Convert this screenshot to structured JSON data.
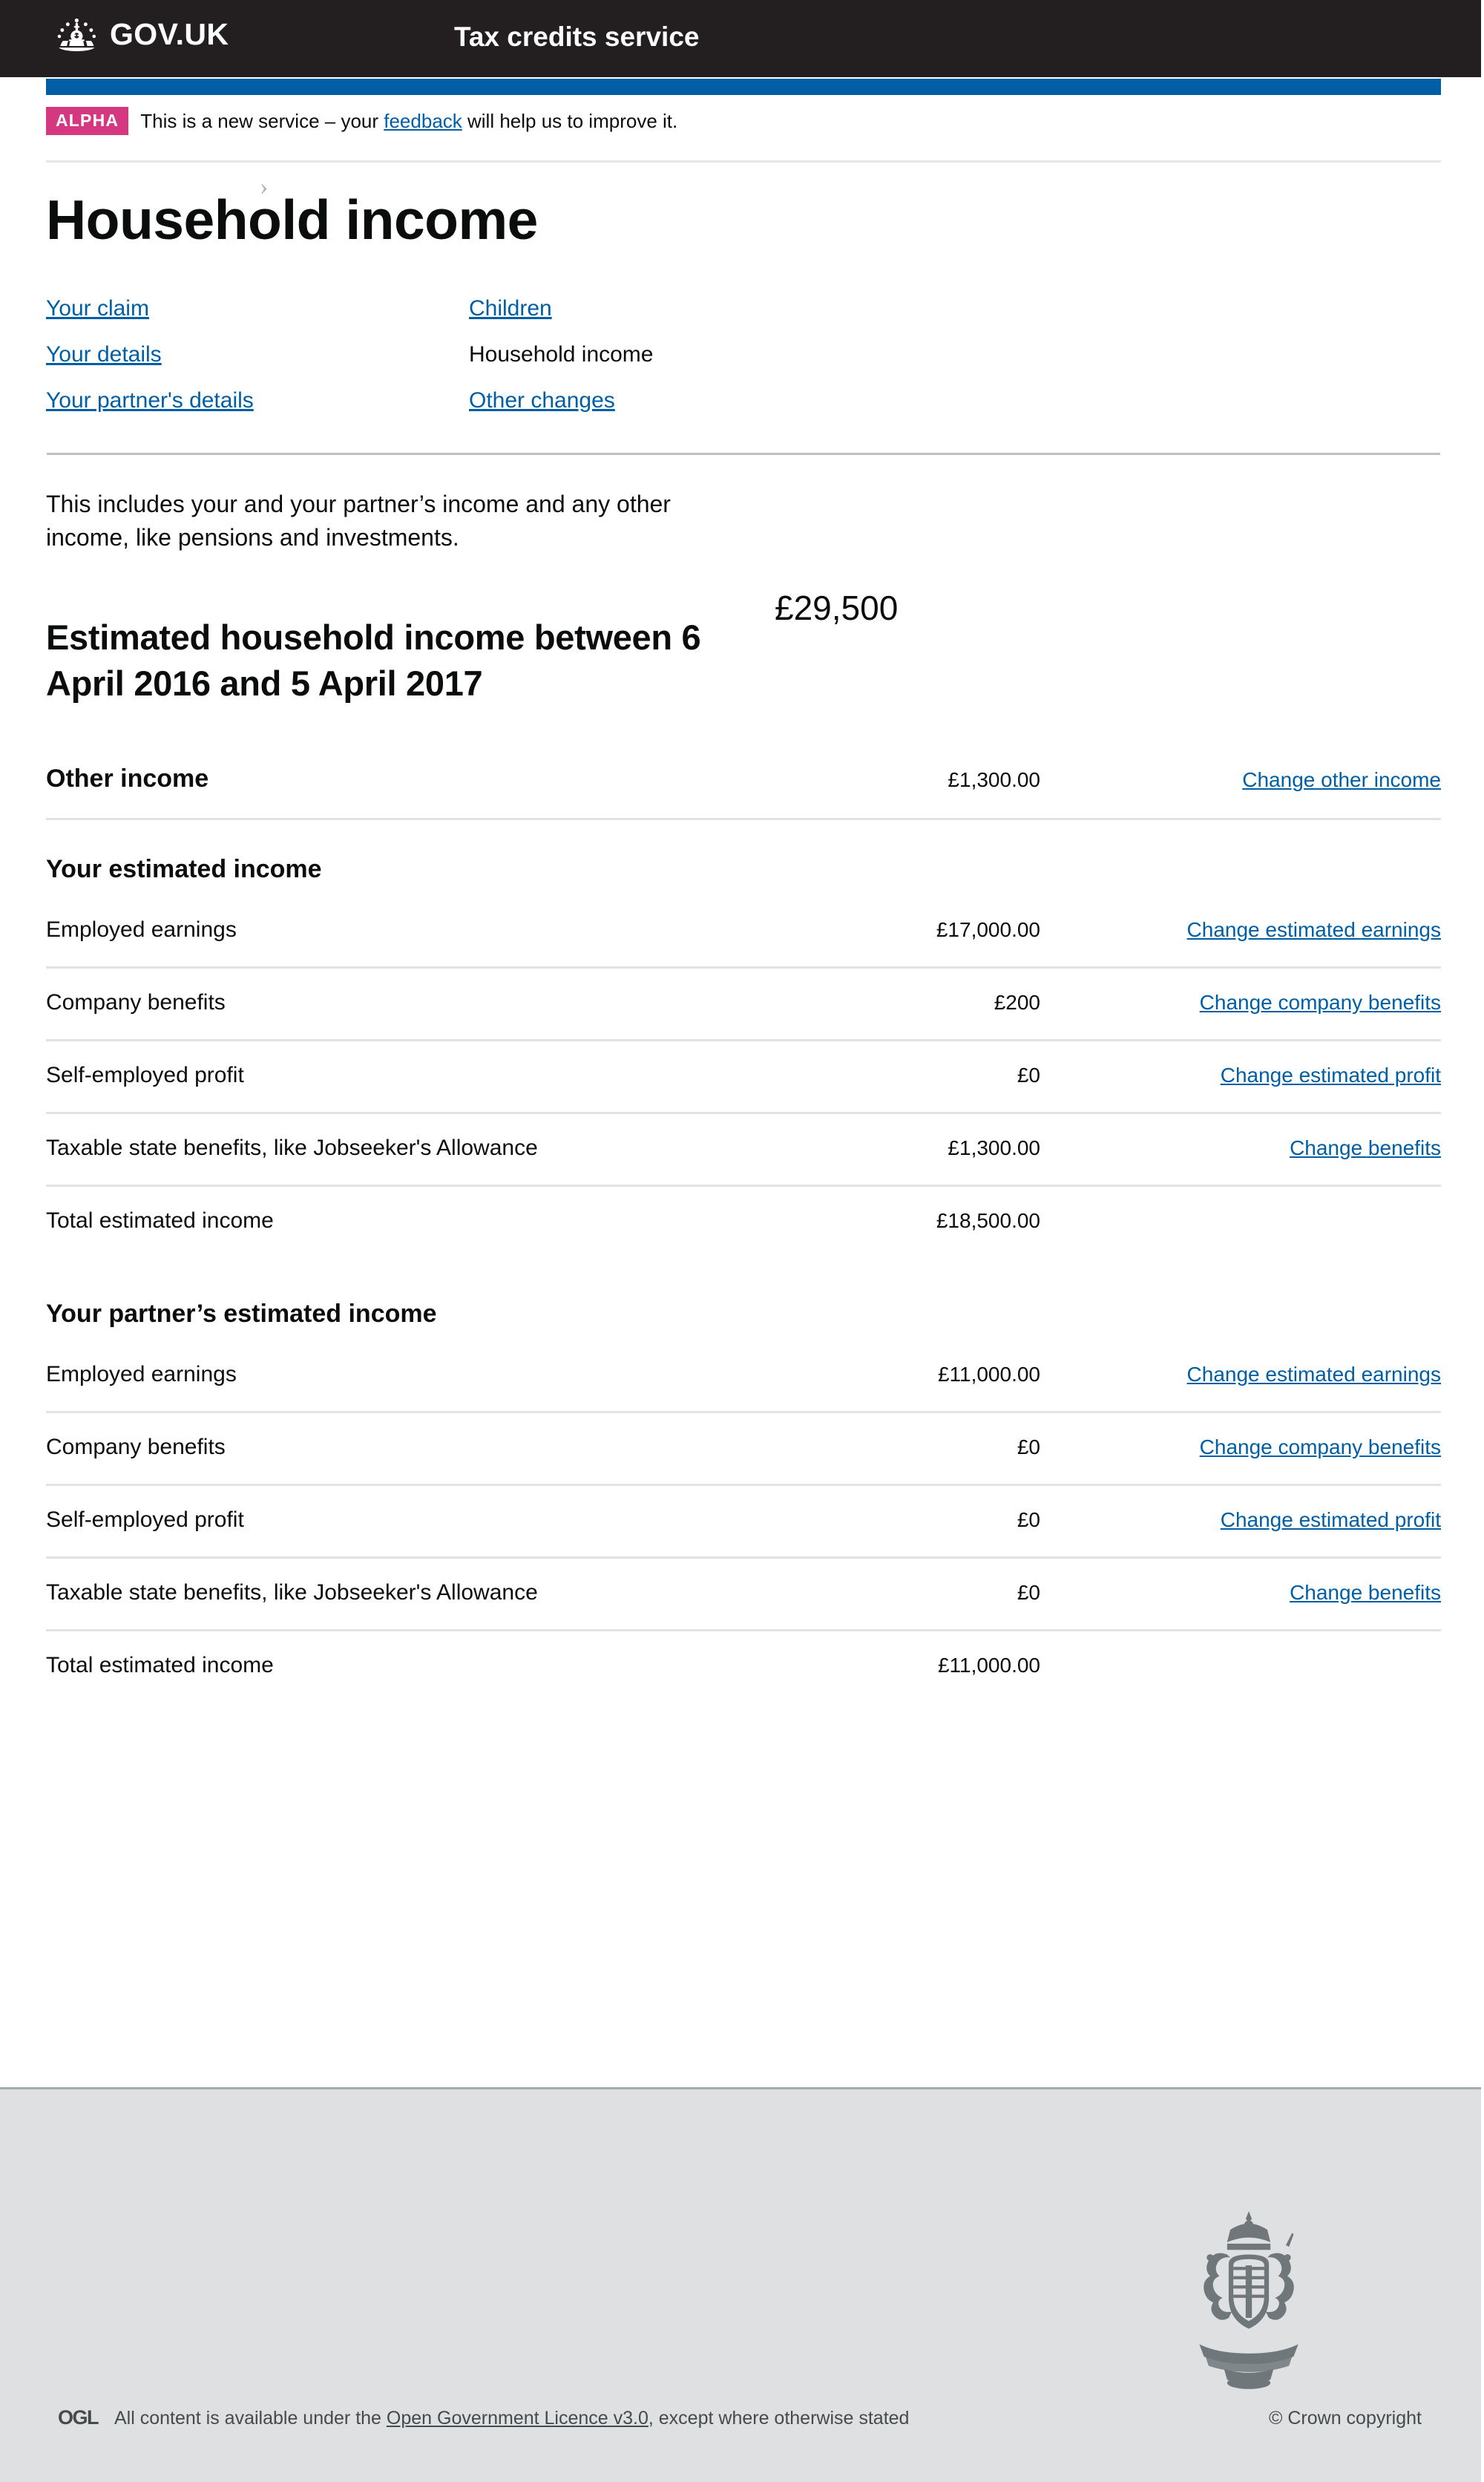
{
  "header": {
    "logo_text": "GOV.UK",
    "crown_icon": "crown-icon",
    "service_name": "Tax credits service"
  },
  "phase_banner": {
    "tag": "ALPHA",
    "text_before": "This is a new service – your ",
    "link": "feedback",
    "text_after": " will help us to improve it."
  },
  "page": {
    "title": "Household income",
    "breadcrumb_chevron": "›"
  },
  "nav": {
    "items": [
      {
        "label": "Your claim",
        "current": false
      },
      {
        "label": "Children",
        "current": false
      },
      {
        "label": "Your details",
        "current": false
      },
      {
        "label": "Household income",
        "current": true
      },
      {
        "label": "Your partner's details",
        "current": false
      },
      {
        "label": "Other changes",
        "current": false
      }
    ]
  },
  "intro": "This includes your and your partner’s income and any other income, like pensions and investments.",
  "hero": {
    "heading": "Estimated household income between 6 April 2016 and 5 April 2017",
    "value": "£29,500"
  },
  "other_income": {
    "label": "Other income",
    "value": "£1,300.00",
    "action": "Change other income"
  },
  "your_income": {
    "heading": "Your estimated income",
    "rows": [
      {
        "label": "Employed earnings",
        "value": "£17,000.00",
        "action": "Change estimated earnings"
      },
      {
        "label": "Company benefits",
        "value": "£200",
        "action": "Change company benefits"
      },
      {
        "label": "Self-employed profit",
        "value": "£0",
        "action": "Change estimated profit"
      },
      {
        "label": "Taxable state benefits, like Jobseeker's Allowance",
        "value": "£1,300.00",
        "action": "Change benefits"
      }
    ],
    "total_label": "Total estimated income",
    "total_value": "£18,500.00"
  },
  "partner_income": {
    "heading": "Your partner’s estimated income",
    "rows": [
      {
        "label": "Employed earnings",
        "value": "£11,000.00",
        "action": "Change estimated earnings"
      },
      {
        "label": "Company benefits",
        "value": "£0",
        "action": "Change company benefits"
      },
      {
        "label": "Self-employed profit",
        "value": "£0",
        "action": "Change estimated profit"
      },
      {
        "label": "Taxable state benefits, like Jobseeker's Allowance",
        "value": "£0",
        "action": "Change benefits"
      }
    ],
    "total_label": "Total estimated income",
    "total_value": "£11,000.00"
  },
  "footer": {
    "ogl_logo": "OGL",
    "license_before": "All content is available under the ",
    "license_link": "Open Government Licence v3.0",
    "license_after": ", except where otherwise stated",
    "copyright": "© Crown copyright",
    "crest_icon": "royal-coat-of-arms-icon"
  },
  "colors": {
    "header_black": "#231f20",
    "brand_blue": "#005ea5",
    "alpha_pink": "#d53880",
    "footer_grey": "#dee0e2",
    "text": "#0b0c0c",
    "border_grey": "#bfc1c3"
  }
}
